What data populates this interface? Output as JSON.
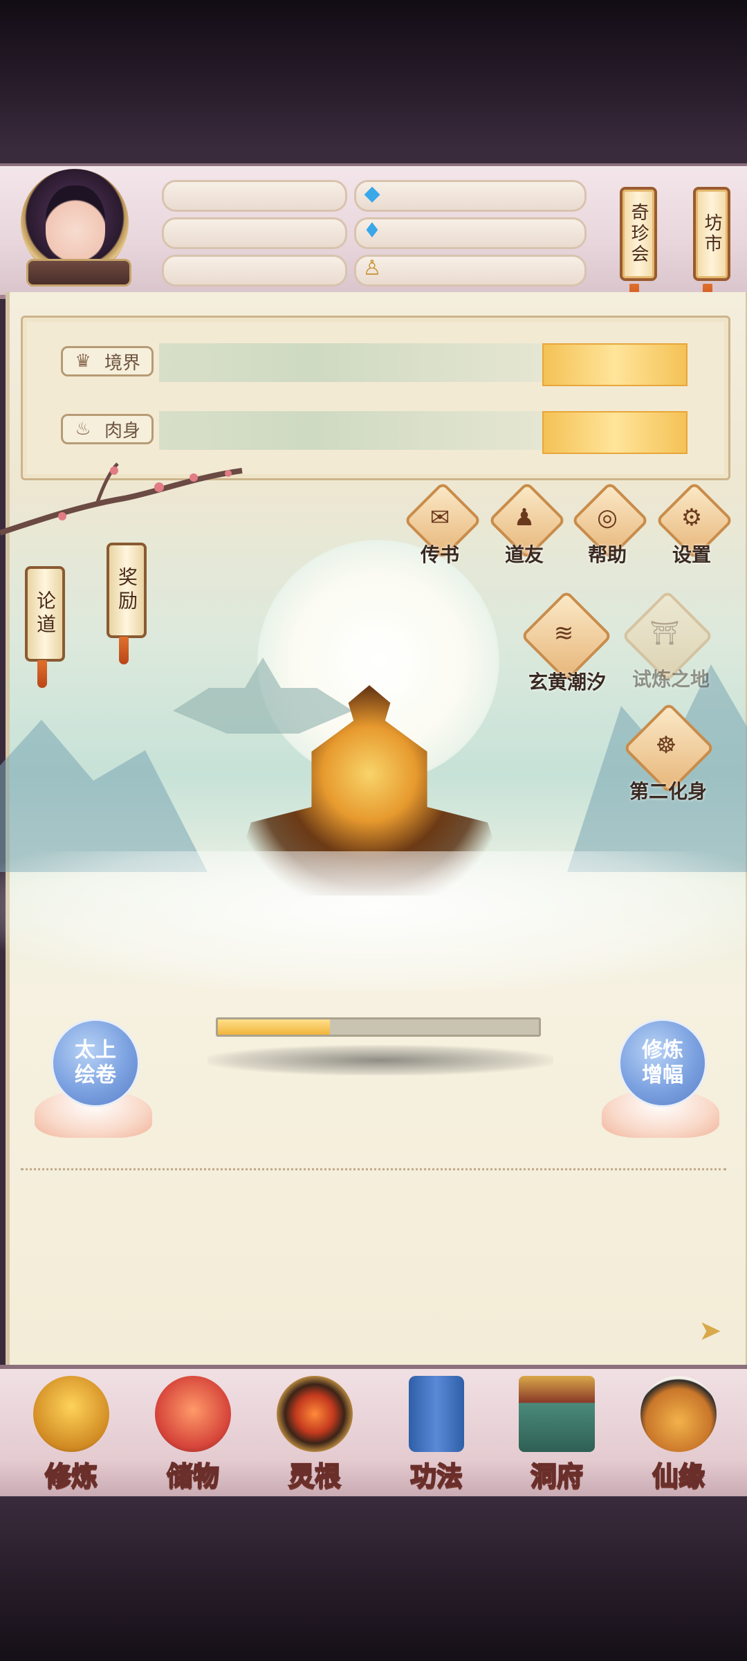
{
  "top_bar": {
    "hanging_signs": [
      {
        "label": "奇珍会",
        "icon": "hanging-sign"
      },
      {
        "label": "坊市",
        "icon": "hanging-sign"
      }
    ],
    "resource_icons": [
      "blue-crystal-icon",
      "blue-flame-icon",
      "meditation-figure-icon"
    ]
  },
  "stats": [
    {
      "label": "境界",
      "icon": "crown-icon"
    },
    {
      "label": "肉身",
      "icon": "flame-icon"
    }
  ],
  "feature_buttons": [
    {
      "label": "传书",
      "icon": "envelope-icon"
    },
    {
      "label": "道友",
      "icon": "person-icon"
    },
    {
      "label": "帮助",
      "icon": "swirl-icon"
    },
    {
      "label": "设置",
      "icon": "gear-icon"
    }
  ],
  "side_scrolls": [
    {
      "label": "论道"
    },
    {
      "label": "奖励"
    }
  ],
  "events": [
    {
      "label": "玄黄潮汐",
      "icon": "tide-icon",
      "enabled": true
    },
    {
      "label": "试炼之地",
      "icon": "temple-icon",
      "enabled": false
    },
    {
      "label": "第二化身",
      "icon": "avatar-figure-icon",
      "enabled": true
    }
  ],
  "cultivation_progress": 0.35,
  "left_bubble": "太上\n绘卷",
  "right_bubble": "修炼\n增幅",
  "bottom_nav": [
    {
      "label": "修炼",
      "icon": "cultivate-icon",
      "active": true
    },
    {
      "label": "储物",
      "icon": "bag-icon",
      "active": false
    },
    {
      "label": "灵根",
      "icon": "spirit-root-icon",
      "active": false
    },
    {
      "label": "功法",
      "icon": "book-icon",
      "active": false
    },
    {
      "label": "洞府",
      "icon": "cave-house-icon",
      "active": false
    },
    {
      "label": "仙缘",
      "icon": "gourd-icon",
      "active": false
    }
  ],
  "colors": {
    "accent_gold": "#f4c256",
    "panel": "#f3ead4",
    "bubble_blue": "#7ba1e0"
  }
}
